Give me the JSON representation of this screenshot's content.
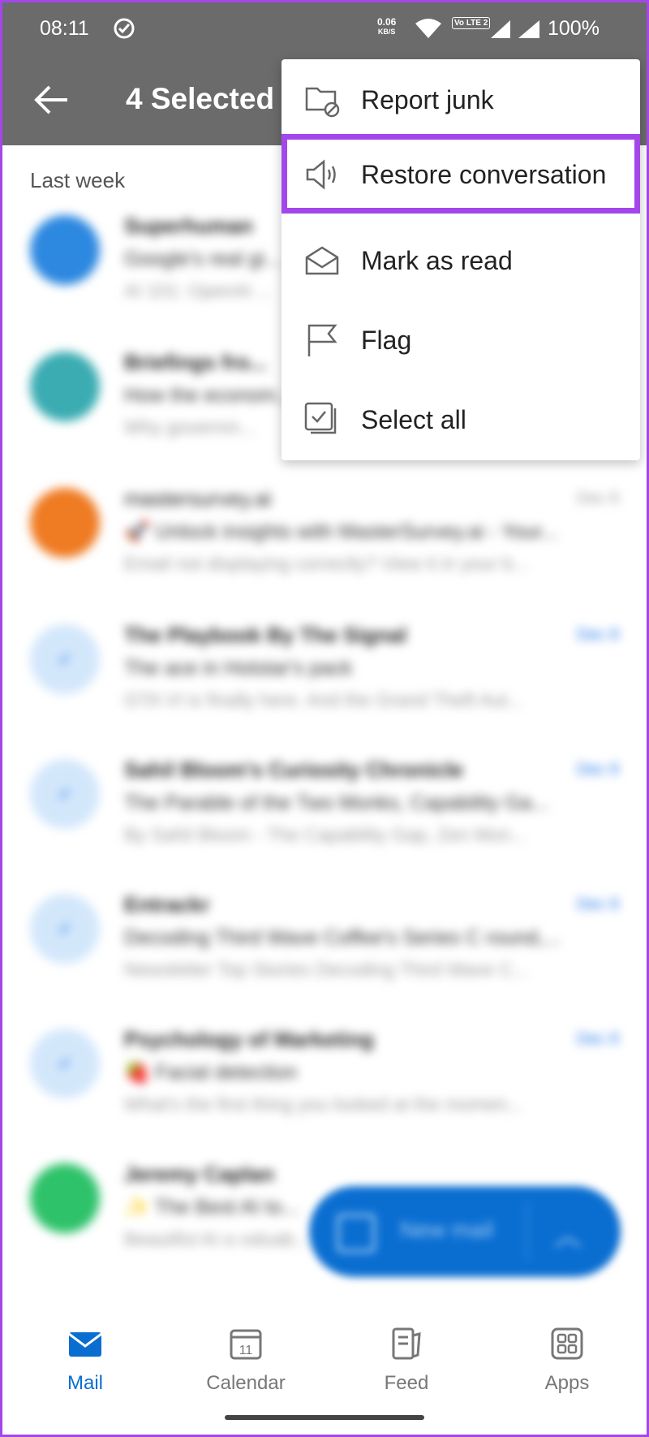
{
  "statusbar": {
    "time": "08:11",
    "net_speed": "0.06",
    "net_unit": "KB/S",
    "lte": "Vo LTE 2",
    "battery": "100%"
  },
  "appbar": {
    "title": "4 Selected"
  },
  "list": {
    "section_label": "Last week",
    "rows": [
      {
        "sender": "Superhuman",
        "subject": "Google's real gi...",
        "preview": "AI 101: OpenAI ...",
        "date": "",
        "avatar_color": "#2d88e0",
        "selected": false
      },
      {
        "sender": "Briefings fro...",
        "subject": "How the econom...",
        "preview": "Why governm...",
        "date": "",
        "avatar_color": "#3aacb2",
        "selected": false
      },
      {
        "sender": "mastersurvey.ai",
        "subject": "🚀 Unlock insights with MasterSurvey.ai - Your...",
        "preview": "Email not displaying correctly? View it in your b...",
        "date": "Dec 8",
        "avatar_color": "#ef7b23",
        "selected": false
      },
      {
        "sender": "The Playbook By The Signal",
        "subject": "The ace in Hotstar's pack",
        "preview": "GTA VI is finally here. And the Grand Theft Aut...",
        "date": "Dec 8",
        "avatar_color": "#d3e7fb",
        "selected": true
      },
      {
        "sender": "Sahil Bloom's Curiosity Chronicle",
        "subject": "The Parable of the Two Monks, Capability Ga...",
        "preview": "By Sahil Bloom - The Capability Gap, Zen Mon...",
        "date": "Dec 8",
        "avatar_color": "#d3e7fb",
        "selected": true
      },
      {
        "sender": "Entrackr",
        "subject": "Decoding Third Wave Coffee's Series C round,...",
        "preview": "Newsletter Top Stories Decoding Third Wave C...",
        "date": "Dec 8",
        "avatar_color": "#d3e7fb",
        "selected": true
      },
      {
        "sender": "Psychology of Marketing",
        "subject": "🍓 Facial detection",
        "preview": "What's the first thing you looked at the momen...",
        "date": "Dec 8",
        "avatar_color": "#d3e7fb",
        "selected": true
      },
      {
        "sender": "Jeremy Caplan",
        "subject": "✨ The Best AI to...",
        "preview": "Beautiful AI a valuab...",
        "date": "",
        "avatar_color": "#2ec26a",
        "selected": false
      }
    ]
  },
  "fab": {
    "label": "New mail"
  },
  "menu": {
    "items": [
      {
        "label": "Report junk",
        "icon": "folder-block-icon"
      },
      {
        "label": "Restore conversation",
        "icon": "megaphone-icon"
      },
      {
        "label": "Mark as read",
        "icon": "envelope-open-icon"
      },
      {
        "label": "Flag",
        "icon": "flag-icon"
      },
      {
        "label": "Select all",
        "icon": "select-all-icon"
      }
    ]
  },
  "bottomnav": {
    "items": [
      {
        "label": "Mail",
        "icon": "mail-icon",
        "active": true
      },
      {
        "label": "Calendar",
        "icon": "calendar-icon",
        "day": "11",
        "active": false
      },
      {
        "label": "Feed",
        "icon": "feed-icon",
        "active": false
      },
      {
        "label": "Apps",
        "icon": "apps-icon",
        "active": false
      }
    ]
  },
  "colors": {
    "accent": "#0a6ed1",
    "highlight": "#a347ea",
    "appbar": "#6b6b6b"
  }
}
